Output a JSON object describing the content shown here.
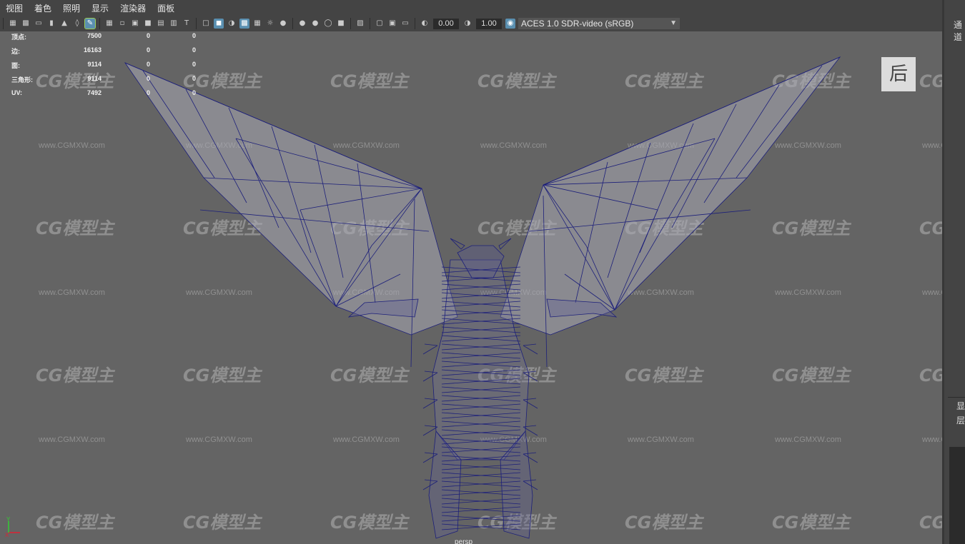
{
  "menu": [
    "视图",
    "着色",
    "照明",
    "显示",
    "渲染器",
    "面板"
  ],
  "toolbar": {
    "exposure": "0.00",
    "gamma": "1.00",
    "color_management": "ACES 1.0 SDR-video (sRGB)",
    "icons": [
      "camera-icon",
      "camera-lock-icon",
      "camera-attr-icon",
      "bookmark-icon",
      "image-plane-icon",
      "grid-view-icon",
      "pencil-icon",
      "grid-icon",
      "film-gate-icon",
      "resolution-gate-icon",
      "field-chart-icon",
      "safe-action-icon",
      "safe-title-icon",
      "wireframe-icon",
      "smooth-shade-icon",
      "default-material-icon",
      "wireframe-on-shaded-icon",
      "textured-icon",
      "lights-icon",
      "shadows-icon",
      "ambient-occlusion-icon",
      "motion-blur-icon",
      "anti-aliasing-icon",
      "depth-of-field-icon",
      "isolate-icon",
      "xray-icon",
      "xray-joints-icon",
      "xray-components-icon",
      "exposure-icon",
      "gamma-icon",
      "color-management-icon"
    ]
  },
  "hud": {
    "rows": [
      {
        "label": "顶点:",
        "v1": "7500",
        "v2": "0",
        "v3": "0"
      },
      {
        "label": "边:",
        "v1": "16163",
        "v2": "0",
        "v3": "0"
      },
      {
        "label": "面:",
        "v1": "9114",
        "v2": "0",
        "v3": "0"
      },
      {
        "label": "三角形:",
        "v1": "9114",
        "v2": "0",
        "v3": "0"
      },
      {
        "label": "UV:",
        "v1": "7492",
        "v2": "0",
        "v3": "0"
      }
    ]
  },
  "viewport": {
    "camera": "persp",
    "view_cube_label": "后"
  },
  "right_panel": {
    "title": "通道",
    "label_display": "显",
    "label_layer": "层"
  },
  "watermark": {
    "logo": "CG模型主",
    "url": "www.CGMXW.com"
  },
  "axis": {
    "x": "X",
    "y": "Y"
  }
}
